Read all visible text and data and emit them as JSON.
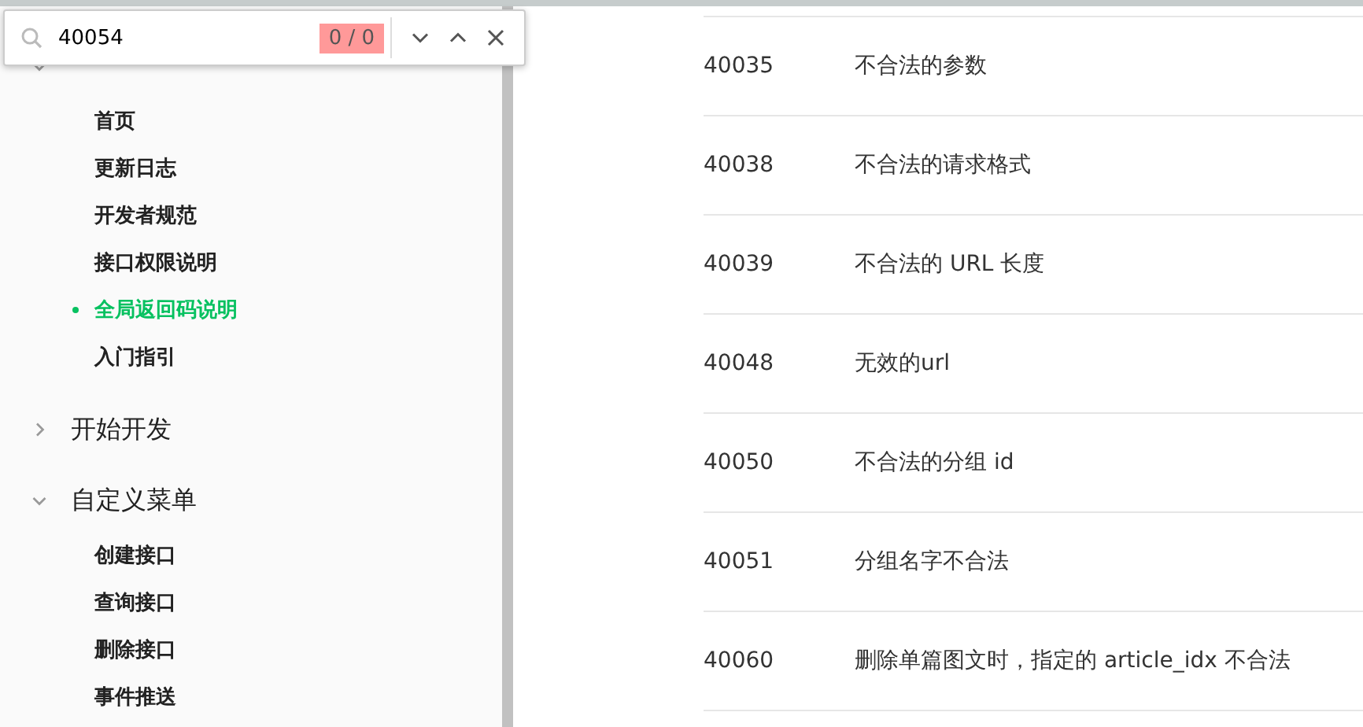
{
  "find_bar": {
    "query": "40054",
    "match_count": "0 / 0"
  },
  "sidebar": {
    "groups": [
      {
        "expanded": true,
        "items": [
          {
            "label": "首页",
            "selected": false
          },
          {
            "label": "更新日志",
            "selected": false
          },
          {
            "label": "开发者规范",
            "selected": false
          },
          {
            "label": "接口权限说明",
            "selected": false
          },
          {
            "label": "全局返回码说明",
            "selected": true
          },
          {
            "label": "入门指引",
            "selected": false
          }
        ]
      },
      {
        "title": "开始开发",
        "expanded": false
      },
      {
        "title": "自定义菜单",
        "expanded": true,
        "items": [
          {
            "label": "创建接口",
            "selected": false
          },
          {
            "label": "查询接口",
            "selected": false
          },
          {
            "label": "删除接口",
            "selected": false
          },
          {
            "label": "事件推送",
            "selected": false
          }
        ]
      }
    ]
  },
  "table": {
    "rows": [
      {
        "code": "40035",
        "description": "不合法的参数"
      },
      {
        "code": "40038",
        "description": "不合法的请求格式"
      },
      {
        "code": "40039",
        "description": "不合法的 URL 长度"
      },
      {
        "code": "40048",
        "description": "无效的url"
      },
      {
        "code": "40050",
        "description": "不合法的分组 id"
      },
      {
        "code": "40051",
        "description": "分组名字不合法"
      },
      {
        "code": "40060",
        "description": "删除单篇图文时，指定的 article_idx 不合法"
      }
    ]
  }
}
